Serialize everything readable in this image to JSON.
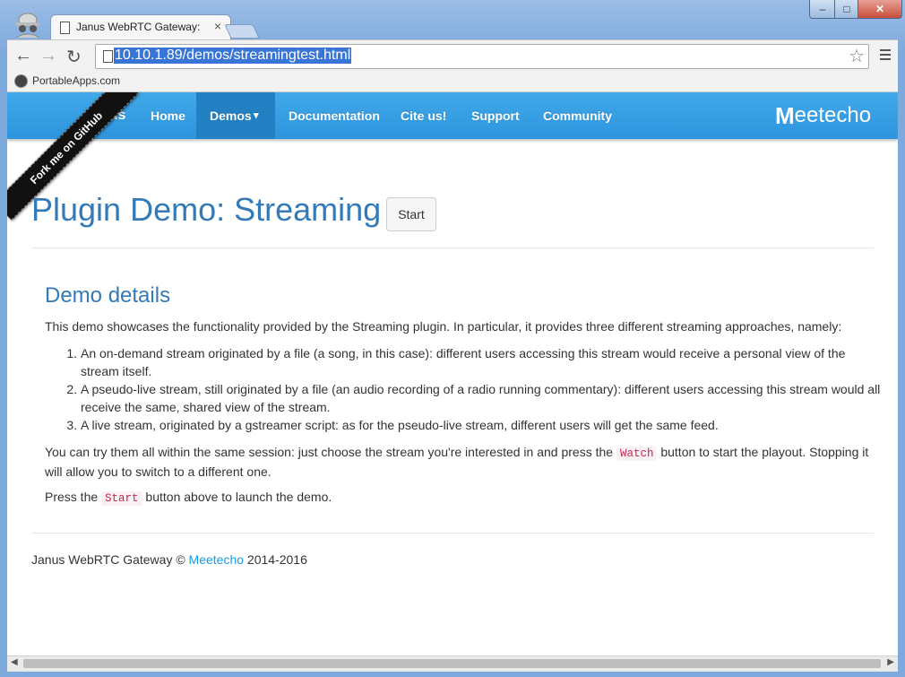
{
  "browser": {
    "tab_title": "Janus WebRTC Gateway: S",
    "tab_close": "×",
    "url": "10.10.1.89/demos/streamingtest.html",
    "bookmark_label": "PortableApps.com",
    "window_controls": {
      "minimize": "–",
      "maximize": "□",
      "close": "✕"
    }
  },
  "navbar": {
    "brand_left": "nus",
    "items": [
      "Home",
      "Demos",
      "Documentation",
      "Cite us!",
      "Support",
      "Community"
    ],
    "demos_caret": "▾",
    "brand_right": {
      "m": "M",
      "rest": "eetecho"
    }
  },
  "ribbon": "Fork me on GitHub",
  "page": {
    "title": "Plugin Demo: Streaming",
    "start_button": "Start",
    "section_title": "Demo details",
    "intro": "This demo showcases the functionality provided by the Streaming plugin. In particular, it provides three different streaming approaches, namely:",
    "list": [
      "An on-demand stream originated by a file (a song, in this case): different users accessing this stream would receive a personal view of the stream itself.",
      "A pseudo-live stream, still originated by a file (an audio recording of a radio running commentary): different users accessing this stream would all receive the same, shared view of the stream.",
      "A live stream, originated by a gstreamer script: as for the pseudo-live stream, different users will get the same feed."
    ],
    "try_pre": "You can try them all within the same session: just choose the stream you're interested in and press the ",
    "watch_code": "Watch",
    "try_post": " button to start the playout. Stopping it will allow you to switch to a different one.",
    "press_pre": "Press the ",
    "start_code": "Start",
    "press_post": " button above to launch the demo.",
    "footer_pre": "Janus WebRTC Gateway © ",
    "footer_link": "Meetecho",
    "footer_post": " 2014-2016"
  },
  "colors": {
    "navbar": "#2d95dd",
    "title": "#337ab7",
    "link": "#1a9be5",
    "code": "#c7254e"
  }
}
